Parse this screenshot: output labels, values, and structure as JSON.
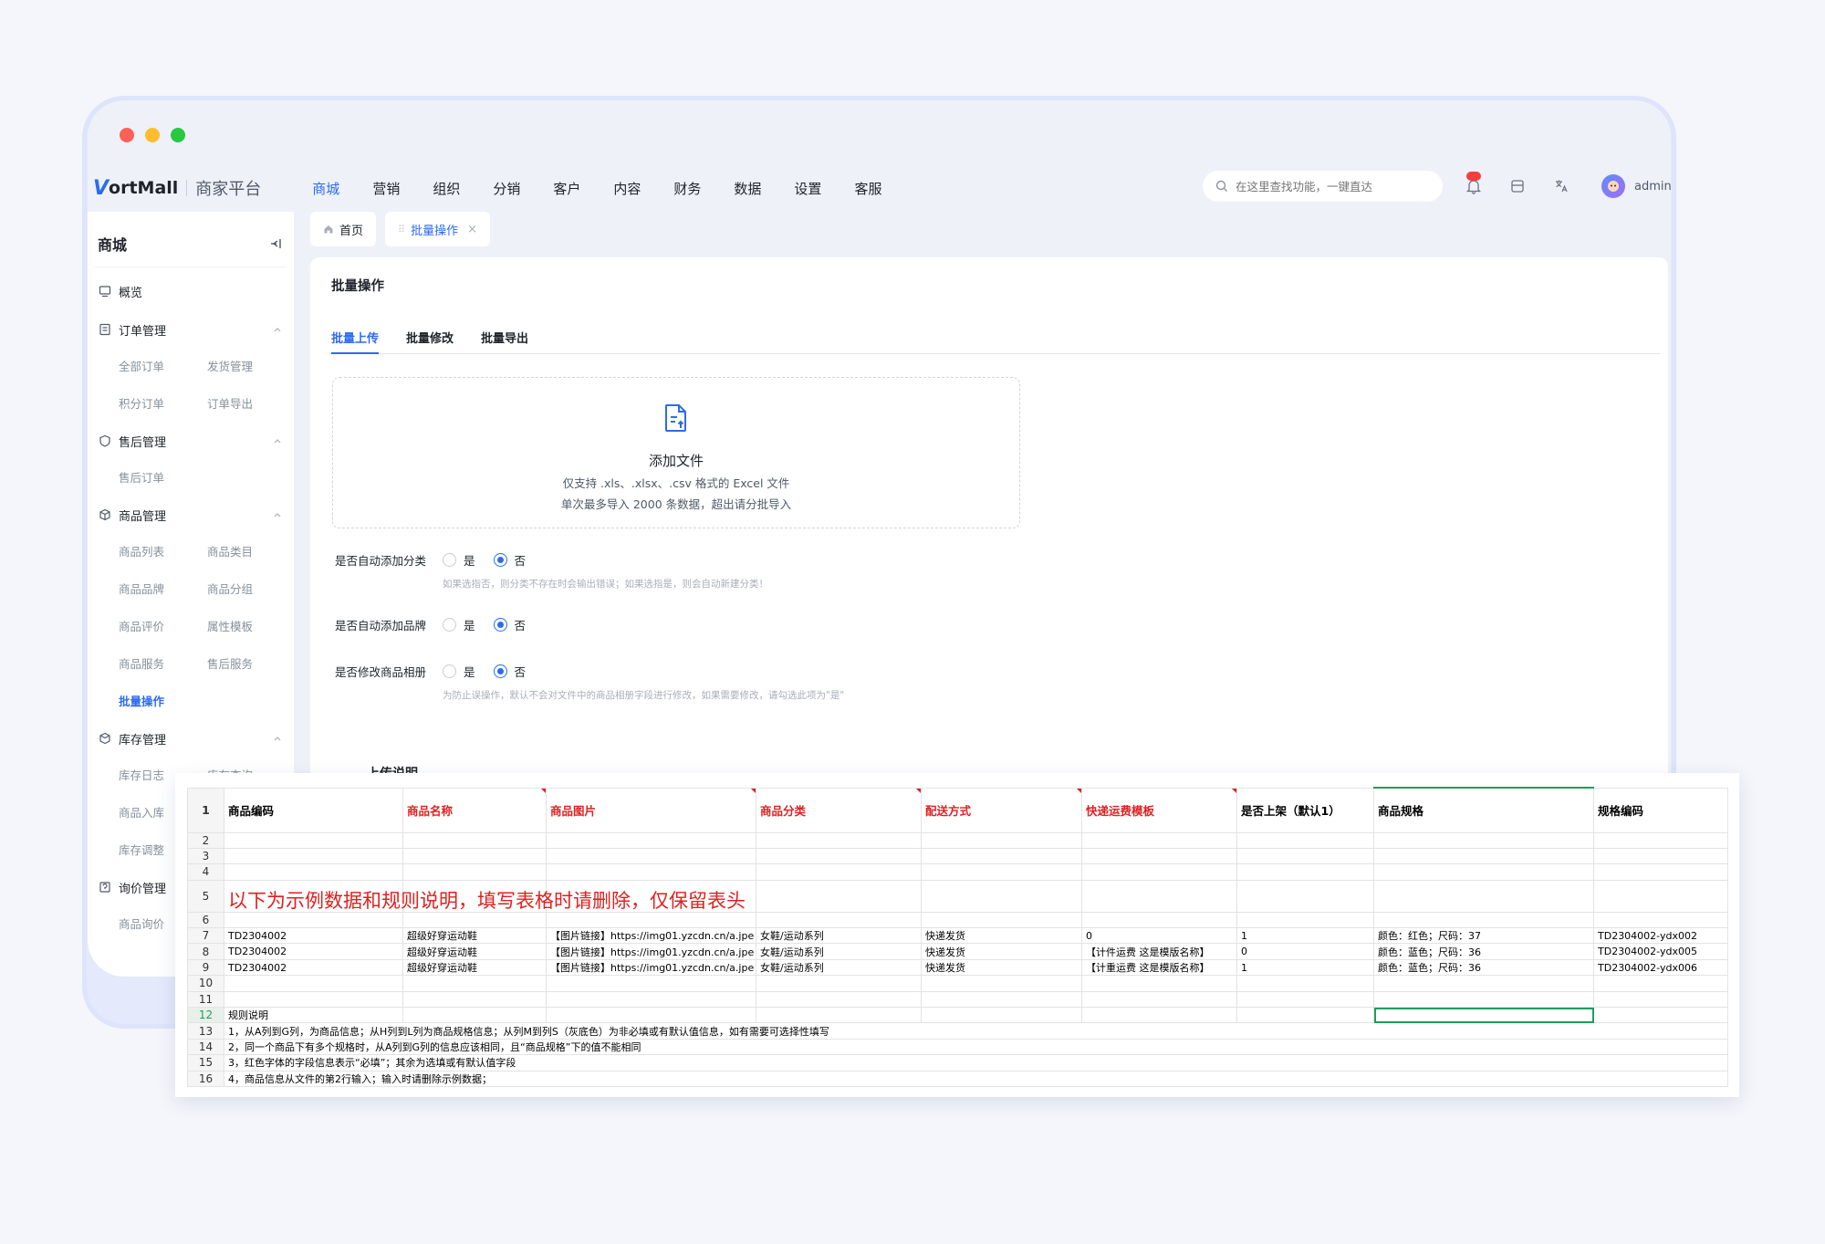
{
  "window": {
    "dot_colors": [
      "#fe5f57",
      "#febc2e",
      "#28c840"
    ]
  },
  "brand": {
    "logo_mark": "V",
    "logo_text": "ortMall",
    "subtitle": "商家平台"
  },
  "top_menu": [
    {
      "label": "商城",
      "active": true
    },
    {
      "label": "营销"
    },
    {
      "label": "组织"
    },
    {
      "label": "分销"
    },
    {
      "label": "客户"
    },
    {
      "label": "内容"
    },
    {
      "label": "财务"
    },
    {
      "label": "数据"
    },
    {
      "label": "设置"
    },
    {
      "label": "客服"
    }
  ],
  "search": {
    "placeholder": "在这里查找功能，一键直达"
  },
  "user": {
    "name": "admin"
  },
  "sidebar": {
    "title": "商城",
    "overview": "概览",
    "groups": [
      {
        "label": "订单管理",
        "items": [
          "全部订单",
          "发货管理",
          "积分订单",
          "订单导出"
        ]
      },
      {
        "label": "售后管理",
        "items": [
          "售后订单"
        ]
      },
      {
        "label": "商品管理",
        "items": [
          "商品列表",
          "商品类目",
          "商品品牌",
          "商品分组",
          "商品评价",
          "属性模板",
          "商品服务",
          "售后服务",
          "批量操作"
        ]
      },
      {
        "label": "库存管理",
        "items": [
          "库存日志",
          "库存查询",
          "商品入库",
          "",
          "库存调整"
        ]
      },
      {
        "label": "询价管理",
        "items": [
          "商品询价"
        ]
      }
    ]
  },
  "tabs": {
    "home": "首页",
    "current": "批量操作"
  },
  "page": {
    "title": "批量操作",
    "subtabs": [
      "批量上传",
      "批量修改",
      "批量导出"
    ],
    "upload": {
      "title": "添加文件",
      "line1": "仅支持 .xls、.xlsx、.csv 格式的 Excel 文件",
      "line2": "单次最多导入 2000 条数据，超出请分批导入"
    },
    "options": [
      {
        "question": "是否自动添加分类",
        "yes": "是",
        "no": "否",
        "hint": "如果选指否，则分类不存在时会输出错误；如果选指是，则会自动新建分类！"
      },
      {
        "question": "是否自动添加品牌",
        "yes": "是",
        "no": "否",
        "hint": ""
      },
      {
        "question": "是否修改商品相册",
        "yes": "是",
        "no": "否",
        "hint": "为防止误操作，默认不会对文件中的商品相册字段进行修改，如果需要修改，请勾选此项为\"是\""
      }
    ],
    "section_title": "上传说明"
  },
  "spreadsheet": {
    "headers": [
      "商品编码",
      "商品名称",
      "商品图片",
      "商品分类",
      "配送方式",
      "快递运费模板",
      "是否上架（默认1）",
      "商品规格",
      "规格编码"
    ],
    "notice": "以下为示例数据和规则说明，填写表格时请删除，仅保留表头",
    "rows": [
      [
        "TD2304002",
        "超级好穿运动鞋",
        "【图片链接】https://img01.yzcdn.cn/a.jpe",
        "女鞋/运动系列",
        "快递发货",
        "0",
        "1",
        "颜色：红色；尺码：37",
        "TD2304002-ydx002"
      ],
      [
        "TD2304002",
        "超级好穿运动鞋",
        "【图片链接】https://img01.yzcdn.cn/a.jpe",
        "女鞋/运动系列",
        "快递发货",
        "【计件运费 这是模版名称】",
        "0",
        "颜色：蓝色；尺码：36",
        "TD2304002-ydx005"
      ],
      [
        "TD2304002",
        "超级好穿运动鞋",
        "【图片链接】https://img01.yzcdn.cn/a.jpe",
        "女鞋/运动系列",
        "快递发货",
        "【计重运费 这是模版名称】",
        "1",
        "颜色：蓝色；尺码：36",
        "TD2304002-ydx006"
      ]
    ],
    "rules_title": "规则说明",
    "rules": [
      "1，从A列到G列，为商品信息；从H列到L列为商品规格信息；从列M到列S（灰底色）为非必填或有默认值信息，如有需要可选择性填写",
      "2，同一个商品下有多个规格时，从A列到G列的信息应该相同，且“商品规格”下的值不能相同",
      "3，红色字体的字段信息表示“必填”；其余为选填或有默认值字段",
      "4，商品信息从文件的第2行输入；输入时请删除示例数据；"
    ],
    "row_numbers": [
      "1",
      "2",
      "3",
      "4",
      "5",
      "6",
      "7",
      "8",
      "9",
      "10",
      "11",
      "12",
      "13",
      "14",
      "15",
      "16"
    ]
  }
}
